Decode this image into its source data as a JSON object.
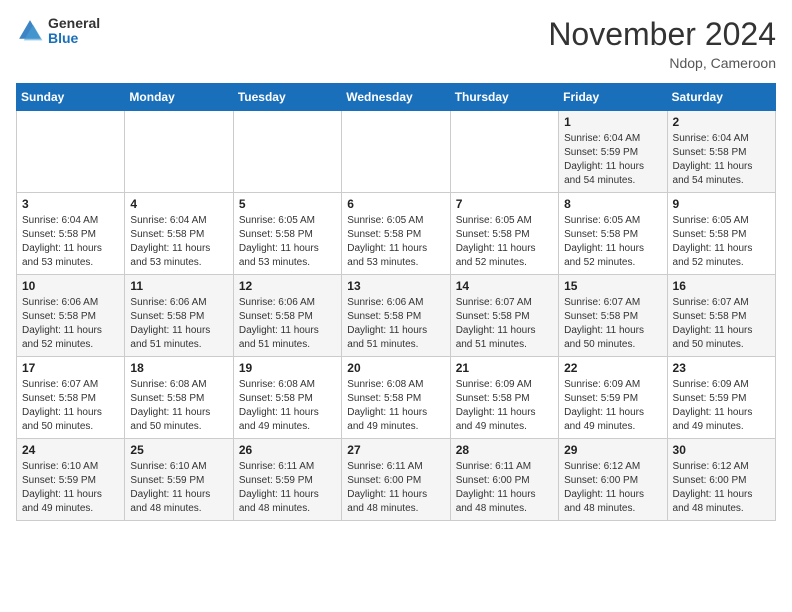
{
  "header": {
    "logo_general": "General",
    "logo_blue": "Blue",
    "month_title": "November 2024",
    "location": "Ndop, Cameroon"
  },
  "days_of_week": [
    "Sunday",
    "Monday",
    "Tuesday",
    "Wednesday",
    "Thursday",
    "Friday",
    "Saturday"
  ],
  "weeks": [
    [
      {
        "day": "",
        "info": ""
      },
      {
        "day": "",
        "info": ""
      },
      {
        "day": "",
        "info": ""
      },
      {
        "day": "",
        "info": ""
      },
      {
        "day": "",
        "info": ""
      },
      {
        "day": "1",
        "info": "Sunrise: 6:04 AM\nSunset: 5:59 PM\nDaylight: 11 hours and 54 minutes."
      },
      {
        "day": "2",
        "info": "Sunrise: 6:04 AM\nSunset: 5:58 PM\nDaylight: 11 hours and 54 minutes."
      }
    ],
    [
      {
        "day": "3",
        "info": "Sunrise: 6:04 AM\nSunset: 5:58 PM\nDaylight: 11 hours and 53 minutes."
      },
      {
        "day": "4",
        "info": "Sunrise: 6:04 AM\nSunset: 5:58 PM\nDaylight: 11 hours and 53 minutes."
      },
      {
        "day": "5",
        "info": "Sunrise: 6:05 AM\nSunset: 5:58 PM\nDaylight: 11 hours and 53 minutes."
      },
      {
        "day": "6",
        "info": "Sunrise: 6:05 AM\nSunset: 5:58 PM\nDaylight: 11 hours and 53 minutes."
      },
      {
        "day": "7",
        "info": "Sunrise: 6:05 AM\nSunset: 5:58 PM\nDaylight: 11 hours and 52 minutes."
      },
      {
        "day": "8",
        "info": "Sunrise: 6:05 AM\nSunset: 5:58 PM\nDaylight: 11 hours and 52 minutes."
      },
      {
        "day": "9",
        "info": "Sunrise: 6:05 AM\nSunset: 5:58 PM\nDaylight: 11 hours and 52 minutes."
      }
    ],
    [
      {
        "day": "10",
        "info": "Sunrise: 6:06 AM\nSunset: 5:58 PM\nDaylight: 11 hours and 52 minutes."
      },
      {
        "day": "11",
        "info": "Sunrise: 6:06 AM\nSunset: 5:58 PM\nDaylight: 11 hours and 51 minutes."
      },
      {
        "day": "12",
        "info": "Sunrise: 6:06 AM\nSunset: 5:58 PM\nDaylight: 11 hours and 51 minutes."
      },
      {
        "day": "13",
        "info": "Sunrise: 6:06 AM\nSunset: 5:58 PM\nDaylight: 11 hours and 51 minutes."
      },
      {
        "day": "14",
        "info": "Sunrise: 6:07 AM\nSunset: 5:58 PM\nDaylight: 11 hours and 51 minutes."
      },
      {
        "day": "15",
        "info": "Sunrise: 6:07 AM\nSunset: 5:58 PM\nDaylight: 11 hours and 50 minutes."
      },
      {
        "day": "16",
        "info": "Sunrise: 6:07 AM\nSunset: 5:58 PM\nDaylight: 11 hours and 50 minutes."
      }
    ],
    [
      {
        "day": "17",
        "info": "Sunrise: 6:07 AM\nSunset: 5:58 PM\nDaylight: 11 hours and 50 minutes."
      },
      {
        "day": "18",
        "info": "Sunrise: 6:08 AM\nSunset: 5:58 PM\nDaylight: 11 hours and 50 minutes."
      },
      {
        "day": "19",
        "info": "Sunrise: 6:08 AM\nSunset: 5:58 PM\nDaylight: 11 hours and 49 minutes."
      },
      {
        "day": "20",
        "info": "Sunrise: 6:08 AM\nSunset: 5:58 PM\nDaylight: 11 hours and 49 minutes."
      },
      {
        "day": "21",
        "info": "Sunrise: 6:09 AM\nSunset: 5:58 PM\nDaylight: 11 hours and 49 minutes."
      },
      {
        "day": "22",
        "info": "Sunrise: 6:09 AM\nSunset: 5:59 PM\nDaylight: 11 hours and 49 minutes."
      },
      {
        "day": "23",
        "info": "Sunrise: 6:09 AM\nSunset: 5:59 PM\nDaylight: 11 hours and 49 minutes."
      }
    ],
    [
      {
        "day": "24",
        "info": "Sunrise: 6:10 AM\nSunset: 5:59 PM\nDaylight: 11 hours and 49 minutes."
      },
      {
        "day": "25",
        "info": "Sunrise: 6:10 AM\nSunset: 5:59 PM\nDaylight: 11 hours and 48 minutes."
      },
      {
        "day": "26",
        "info": "Sunrise: 6:11 AM\nSunset: 5:59 PM\nDaylight: 11 hours and 48 minutes."
      },
      {
        "day": "27",
        "info": "Sunrise: 6:11 AM\nSunset: 6:00 PM\nDaylight: 11 hours and 48 minutes."
      },
      {
        "day": "28",
        "info": "Sunrise: 6:11 AM\nSunset: 6:00 PM\nDaylight: 11 hours and 48 minutes."
      },
      {
        "day": "29",
        "info": "Sunrise: 6:12 AM\nSunset: 6:00 PM\nDaylight: 11 hours and 48 minutes."
      },
      {
        "day": "30",
        "info": "Sunrise: 6:12 AM\nSunset: 6:00 PM\nDaylight: 11 hours and 48 minutes."
      }
    ]
  ]
}
